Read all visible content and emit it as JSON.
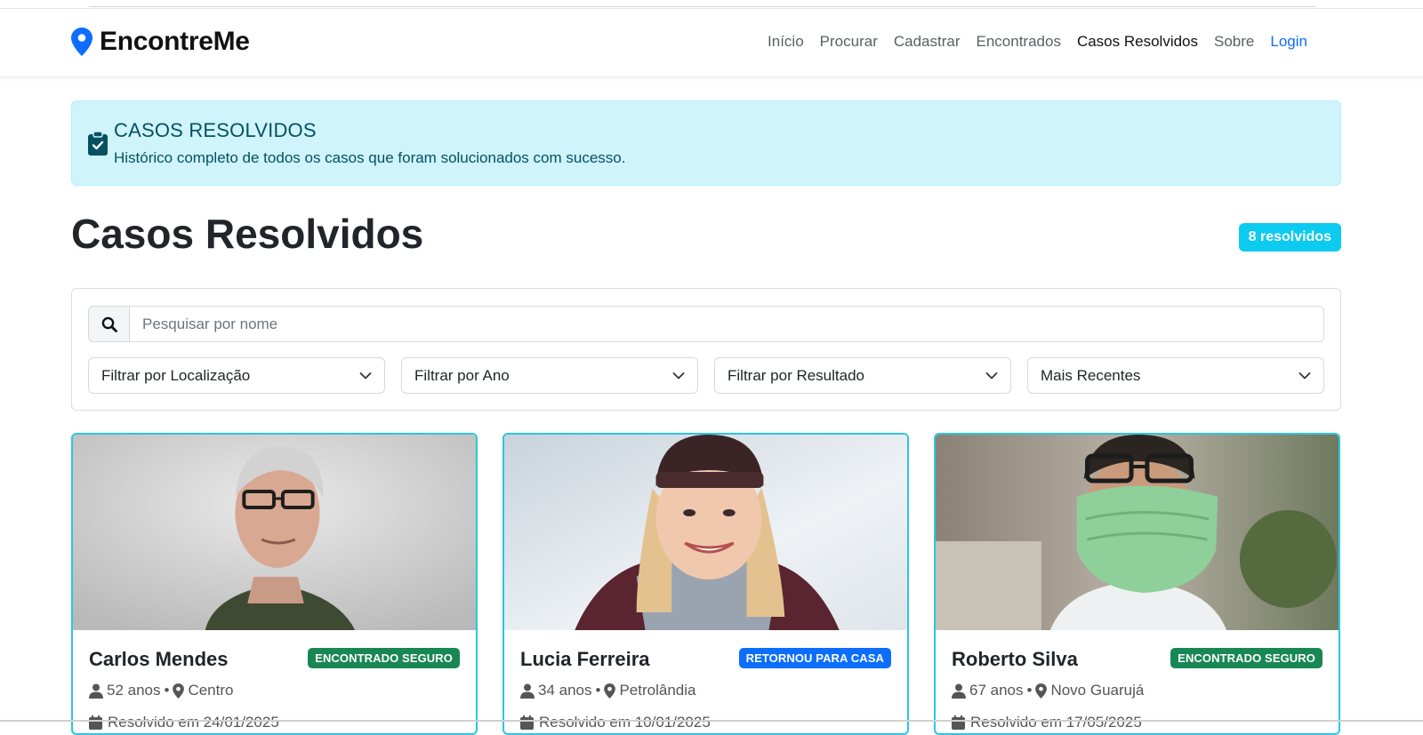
{
  "brand": {
    "name": "EncontreMe",
    "icon": "map-pin-icon",
    "icon_color": "#0d6efd"
  },
  "nav": {
    "items": [
      {
        "label": "Início",
        "state": "default"
      },
      {
        "label": "Procurar",
        "state": "default"
      },
      {
        "label": "Cadastrar",
        "state": "default"
      },
      {
        "label": "Encontrados",
        "state": "default"
      },
      {
        "label": "Casos Resolvidos",
        "state": "active"
      },
      {
        "label": "Sobre",
        "state": "default"
      },
      {
        "label": "Login",
        "state": "link"
      }
    ]
  },
  "alert": {
    "icon": "clipboard-check-icon",
    "title": "CASOS RESOLVIDOS",
    "text": "Histórico completo de todos os casos que foram solucionados com sucesso.",
    "bg_color": "#cff4fc",
    "text_color": "#055160"
  },
  "page": {
    "title": "Casos Resolvidos",
    "count_badge": "8 resolvidos",
    "badge_color": "#0dcaf0"
  },
  "filters": {
    "search_placeholder": "Pesquisar por nome",
    "search_icon": "search-icon",
    "selects": [
      {
        "value": "Filtrar por Localização"
      },
      {
        "value": "Filtrar por Ano"
      },
      {
        "value": "Filtrar por Resultado"
      },
      {
        "value": "Mais Recentes"
      }
    ]
  },
  "cases": [
    {
      "name": "Carlos Mendes",
      "status": "ENCONTRADO SEGURO",
      "status_color": "#198754",
      "age": "52 anos",
      "location": "Centro",
      "date": "Resolvido em 24/01/2025"
    },
    {
      "name": "Lucia Ferreira",
      "status": "RETORNOU PARA CASA",
      "status_color": "#0d6efd",
      "age": "34 anos",
      "location": "Petrolândia",
      "date": "Resolvido em 10/01/2025"
    },
    {
      "name": "Roberto Silva",
      "status": "ENCONTRADO SEGURO",
      "status_color": "#198754",
      "age": "67 anos",
      "location": "Novo Guarujá",
      "date": "Resolvido em 17/05/2025"
    }
  ]
}
